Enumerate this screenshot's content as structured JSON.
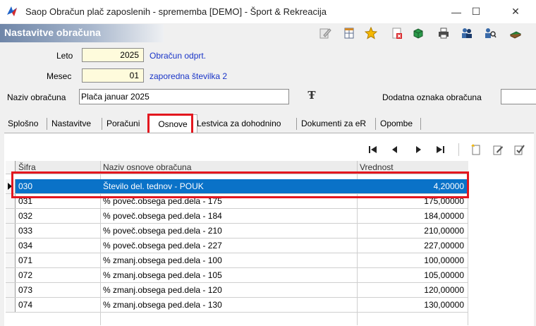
{
  "window": {
    "title": "Saop Obračun plač zaposlenih - sprememba [DEMO] - Šport & Rekreacija",
    "minimize_glyph": "—",
    "maximize_glyph": "☐",
    "close_glyph": "✕"
  },
  "form": {
    "title": "Nastavitve obračuna"
  },
  "toolbar": {
    "icons": [
      "edit-icon",
      "table-icon",
      "star-icon",
      "close-form-icon",
      "cube-icon",
      "print-icon",
      "users-icon",
      "search-users-icon",
      "book-icon"
    ]
  },
  "fields": {
    "leto_label": "Leto",
    "leto_value": "2025",
    "leto_status": "Obračun odprt.",
    "mesec_label": "Mesec",
    "mesec_value": "01",
    "mesec_status": "zaporedna številka 2",
    "naziv_label": "Naziv obračuna",
    "naziv_value": "Plača januar 2025",
    "format_glyph": "Ŧ",
    "dodatna_label": "Dodatna oznaka obračuna",
    "dodatna_value": ""
  },
  "tabs": [
    "Splošno",
    "Nastavitve",
    "Poračuni",
    "Osnove",
    "Lestvica za dohodnino",
    "Dokumenti za eR",
    "Opombe"
  ],
  "active_tab": "Osnove",
  "table": {
    "headers": [
      "Šifra",
      "Naziv osnove obračuna",
      "Vrednost"
    ],
    "rows": [
      {
        "sifra": "030",
        "naziv": "Število del. tednov - POUK",
        "vrednost": "4,20000"
      },
      {
        "sifra": "031",
        "naziv": "% poveč.obsega ped.dela - 175",
        "vrednost": "175,00000"
      },
      {
        "sifra": "032",
        "naziv": "% poveč.obsega ped.dela - 184",
        "vrednost": "184,00000"
      },
      {
        "sifra": "033",
        "naziv": "% poveč.obsega ped.dela - 210",
        "vrednost": "210,00000"
      },
      {
        "sifra": "034",
        "naziv": "% poveč.obsega ped.dela - 227",
        "vrednost": "227,00000"
      },
      {
        "sifra": "071",
        "naziv": "% zmanj.obsega ped.dela - 100",
        "vrednost": "100,00000"
      },
      {
        "sifra": "072",
        "naziv": "% zmanj.obsega ped.dela - 105",
        "vrednost": "105,00000"
      },
      {
        "sifra": "073",
        "naziv": "% zmanj.obsega ped.dela - 120",
        "vrednost": "120,00000"
      },
      {
        "sifra": "074",
        "naziv": "% zmanj.obsega ped.dela - 130",
        "vrednost": "130,00000"
      }
    ],
    "selected_row": 0
  },
  "colors": {
    "selection": "#0a72c8",
    "highlight_border": "#e3171f",
    "link_blue": "#1a35c8",
    "input_yellow": "#fefbdc"
  }
}
